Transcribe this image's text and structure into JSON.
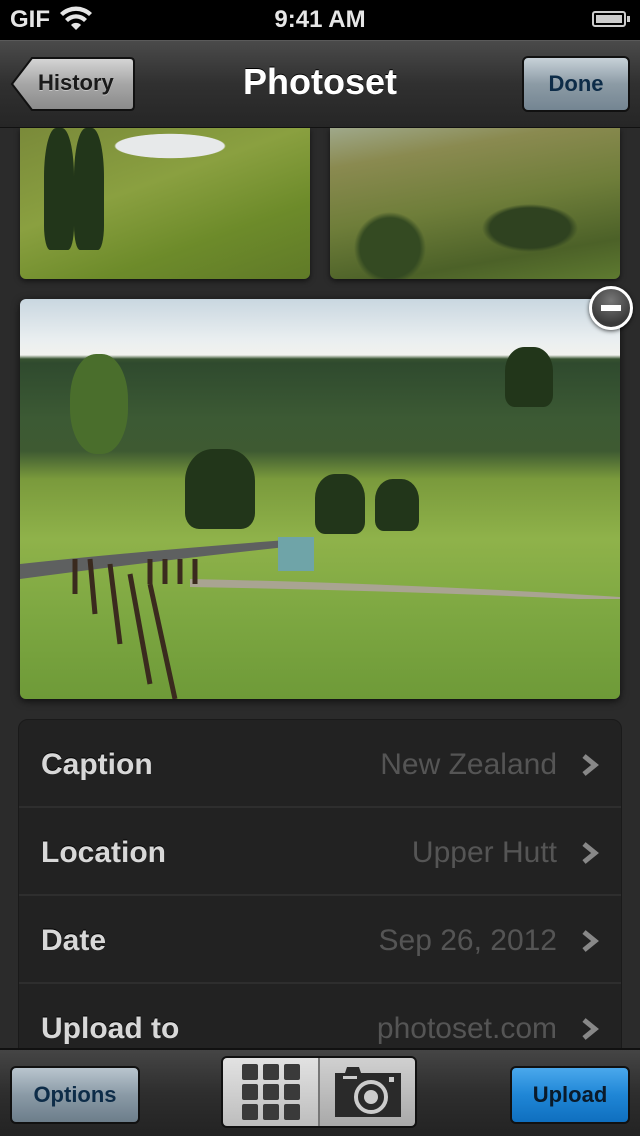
{
  "status_bar": {
    "carrier": "GIF",
    "time": "9:41 AM"
  },
  "nav": {
    "back_label": "History",
    "title": "Photoset",
    "done_label": "Done"
  },
  "photos": [
    {
      "name": "thumbnail-hills-poplars"
    },
    {
      "name": "thumbnail-valley"
    },
    {
      "name": "main-photo-countryside-road"
    }
  ],
  "details": {
    "rows": [
      {
        "label": "Caption",
        "value": "New Zealand"
      },
      {
        "label": "Location",
        "value": "Upper Hutt"
      },
      {
        "label": "Date",
        "value": "Sep 26, 2012"
      },
      {
        "label": "Upload to",
        "value": "photoset.com"
      }
    ]
  },
  "toolbar": {
    "options_label": "Options",
    "upload_label": "Upload"
  },
  "colors": {
    "upload_accent": "#1f86d6",
    "done_accent": "#0d2c48"
  }
}
